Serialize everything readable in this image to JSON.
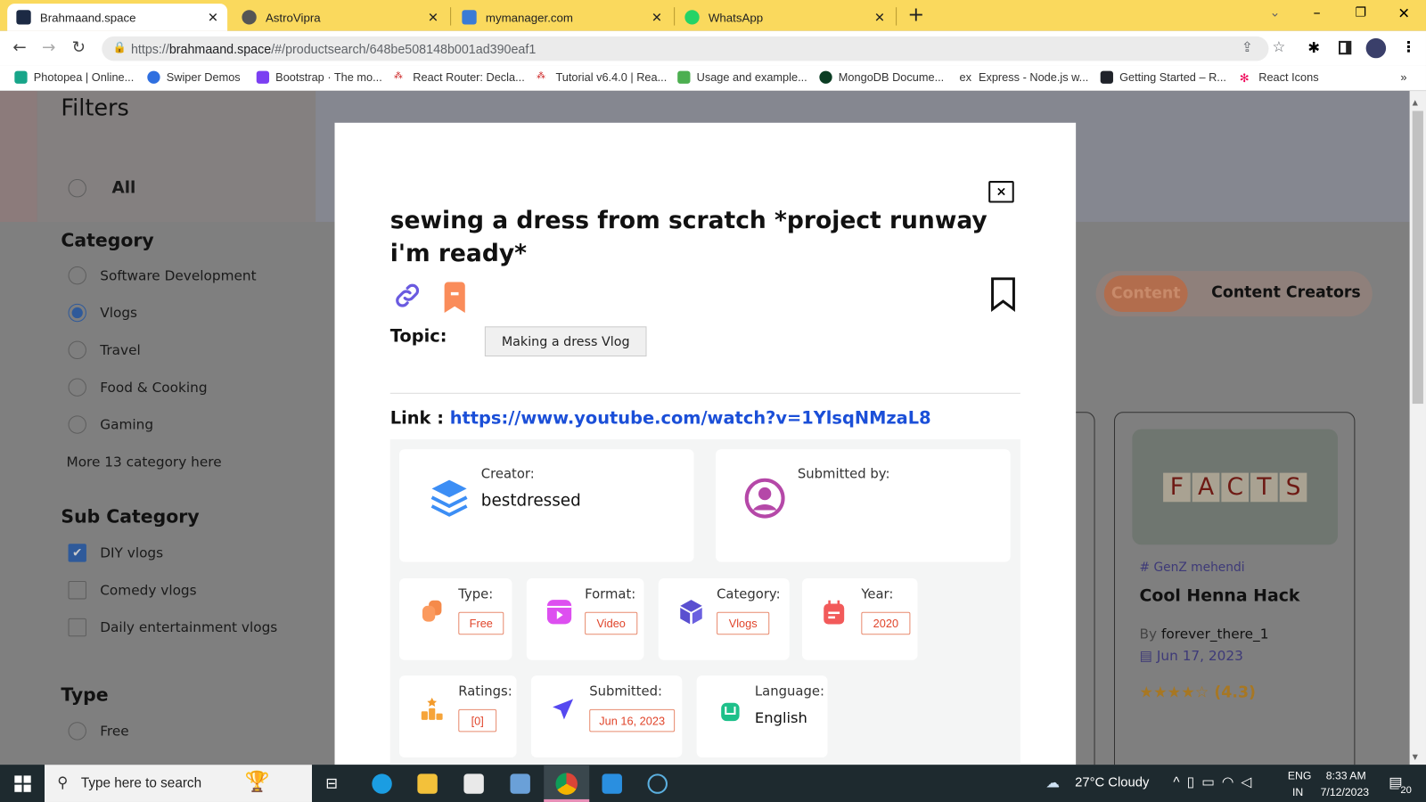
{
  "browser": {
    "tabs": [
      {
        "title": "Brahmaand.space",
        "active": true
      },
      {
        "title": "AstroVipra"
      },
      {
        "title": "mymanager.com"
      },
      {
        "title": "WhatsApp"
      }
    ],
    "new_tab": "+",
    "url_prefix": "https://",
    "url_host": "brahmaand.space",
    "url_path": "/#/productsearch/648be508148b001ad390eaf1",
    "bookmarks": [
      "Photopea | Online...",
      "Swiper Demos",
      "Bootstrap · The mo...",
      "React Router: Decla...",
      "Tutorial v6.4.0 | Rea...",
      "Usage and example...",
      "MongoDB Docume...",
      "Express - Node.js w...",
      "Getting Started – R...",
      "React Icons"
    ],
    "bookmarks_overflow": "»"
  },
  "filters": {
    "title": "Filters",
    "all_label": "All",
    "category_title": "Category",
    "categories": [
      {
        "label": "Software Development",
        "checked": false
      },
      {
        "label": "Vlogs",
        "checked": true
      },
      {
        "label": "Travel",
        "checked": false
      },
      {
        "label": "Food & Cooking",
        "checked": false
      },
      {
        "label": "Gaming",
        "checked": false
      }
    ],
    "more_link": "More 13 category here",
    "subcategory_title": "Sub Category",
    "subcategories": [
      {
        "label": "DIY vlogs",
        "checked": true
      },
      {
        "label": "Comedy vlogs",
        "checked": false
      },
      {
        "label": "Daily entertainment vlogs",
        "checked": false
      }
    ],
    "type_title": "Type",
    "types": [
      {
        "label": "Free",
        "checked": false
      }
    ]
  },
  "toggle": {
    "content": "Content",
    "creators": "Content Creators",
    "active": "content"
  },
  "product_card": {
    "thumb_letters": [
      "F",
      "A",
      "C",
      "T",
      "S"
    ],
    "tag": "# GenZ mehendi",
    "title": "Cool Henna Hack",
    "by": "By",
    "author": "forever_there_1",
    "date": "Jun 17, 2023",
    "rating": 4.3,
    "rating_text": "(4.3)"
  },
  "modal": {
    "title": "sewing a dress from scratch *project runway i'm ready*",
    "close": "×",
    "topic_label": "Topic:",
    "topic_value": "Making a dress Vlog",
    "link_label": "Link :",
    "link_url": "https://www.youtube.com/watch?v=1YlsqNMzaL8",
    "creator_label": "Creator:",
    "creator_value": "bestdressed",
    "submitted_by_label": "Submitted by:",
    "type_label": "Type:",
    "type_value": "Free",
    "format_label": "Format:",
    "format_value": "Video",
    "category_label": "Category:",
    "category_value": "Vlogs",
    "year_label": "Year:",
    "year_value": "2020",
    "ratings_label": "Ratings:",
    "ratings_value": "[0]",
    "submitted_label": "Submitted:",
    "submitted_value": "Jun 16, 2023",
    "language_label": "Language:",
    "language_value": "English"
  },
  "taskbar": {
    "search_placeholder": "Type here to search",
    "weather": "27°C  Cloudy",
    "lang1": "ENG",
    "lang2": "IN",
    "time": "8:33 AM",
    "date": "7/12/2023",
    "notifications": "20"
  },
  "colors": {
    "accent": "#1b4fd8",
    "chip": "#e0442a",
    "tabbar": "#fad95d"
  }
}
